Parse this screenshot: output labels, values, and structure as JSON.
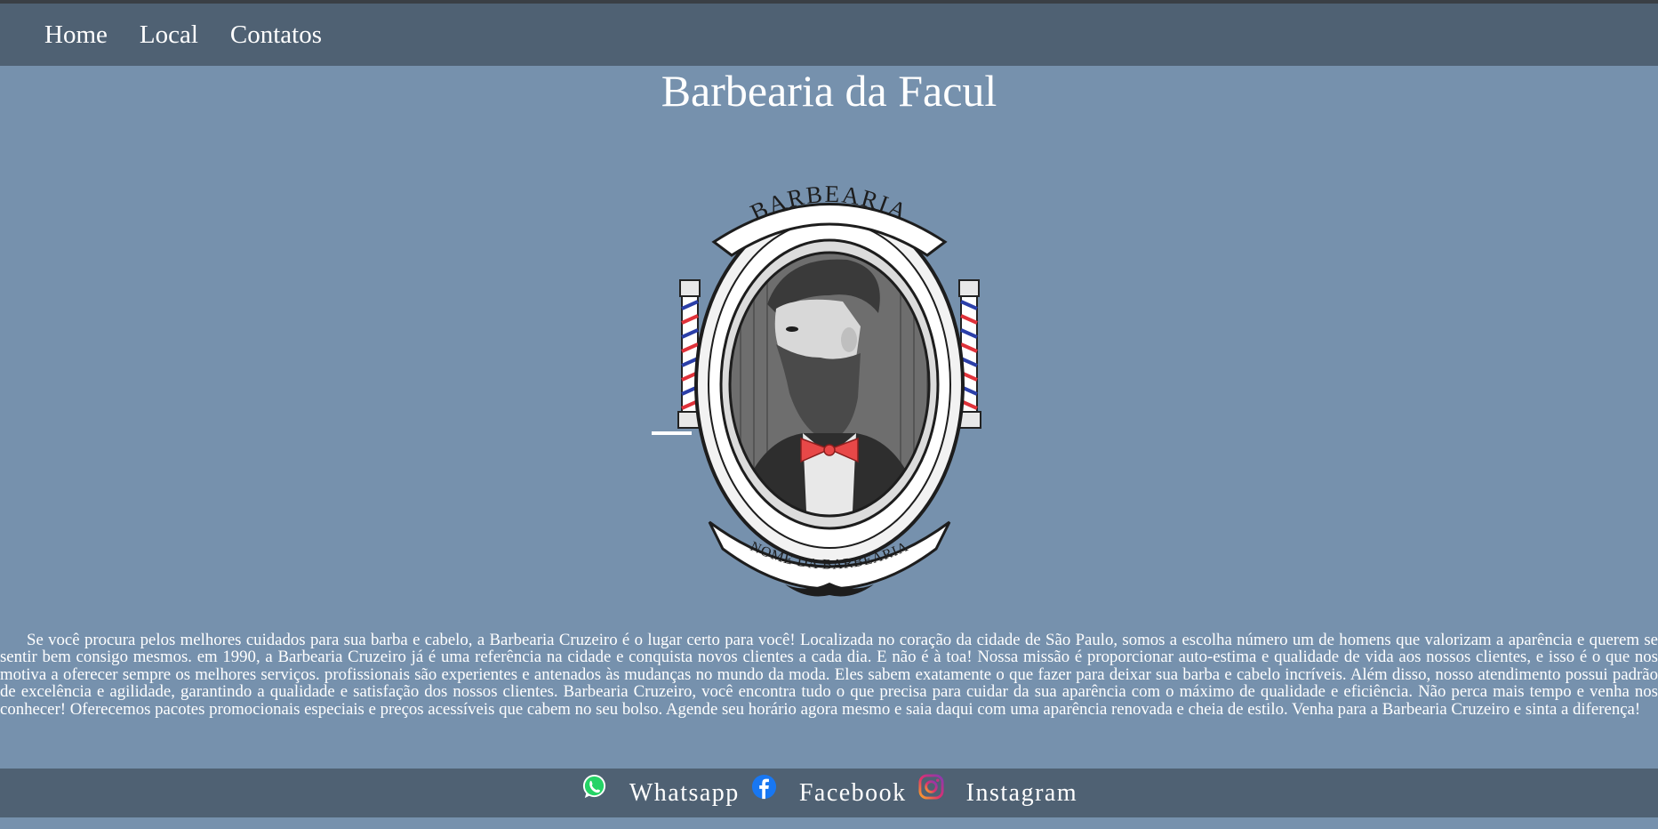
{
  "nav": {
    "items": [
      {
        "label": "Home"
      },
      {
        "label": "Local"
      },
      {
        "label": "Contatos"
      }
    ]
  },
  "page": {
    "title": "Barbearia da Facul"
  },
  "logo": {
    "top_text": "BARBEARIA",
    "bottom_text": "NOME DA BARBEARIA"
  },
  "about": {
    "text": "Se você procura pelos melhores cuidados para sua barba e cabelo, a Barbearia Cruzeiro é o lugar certo para você! Localizada no coração da cidade de São Paulo, somos a escolha número um de homens que valorizam a aparência e querem se sentir bem consigo mesmos. em 1990, a Barbearia Cruzeiro já é uma referência na cidade e conquista novos clientes a cada dia. E não é à toa! Nossa missão é proporcionar auto-estima e qualidade de vida aos nossos clientes, e isso é o que nos motiva a oferecer sempre os melhores serviços. profissionais são experientes e antenados às mudanças no mundo da moda. Eles sabem exatamente o que fazer para deixar sua barba e cabelo incríveis. Além disso, nosso atendimento possui padrão de excelência e agilidade, garantindo a qualidade e satisfação dos nossos clientes. Barbearia Cruzeiro, você encontra tudo o que precisa para cuidar da sua aparência com o máximo de qualidade e eficiência. Não perca mais tempo e venha nos conhecer! Oferecemos pacotes promocionais especiais e preços acessíveis que cabem no seu bolso. Agende seu horário agora mesmo e saia daqui com uma aparência renovada e cheia de estilo. Venha para a Barbearia Cruzeiro e sinta a diferença!"
  },
  "footer": {
    "links": [
      {
        "label": "Whatsapp",
        "icon": "whatsapp-icon"
      },
      {
        "label": "Facebook",
        "icon": "facebook-icon"
      },
      {
        "label": "Instagram",
        "icon": "instagram-icon"
      }
    ]
  },
  "colors": {
    "background": "#7691ad",
    "navbar": "#4f6173",
    "text": "#ffffff",
    "whatsapp": "#25d366",
    "facebook": "#1877f2"
  }
}
